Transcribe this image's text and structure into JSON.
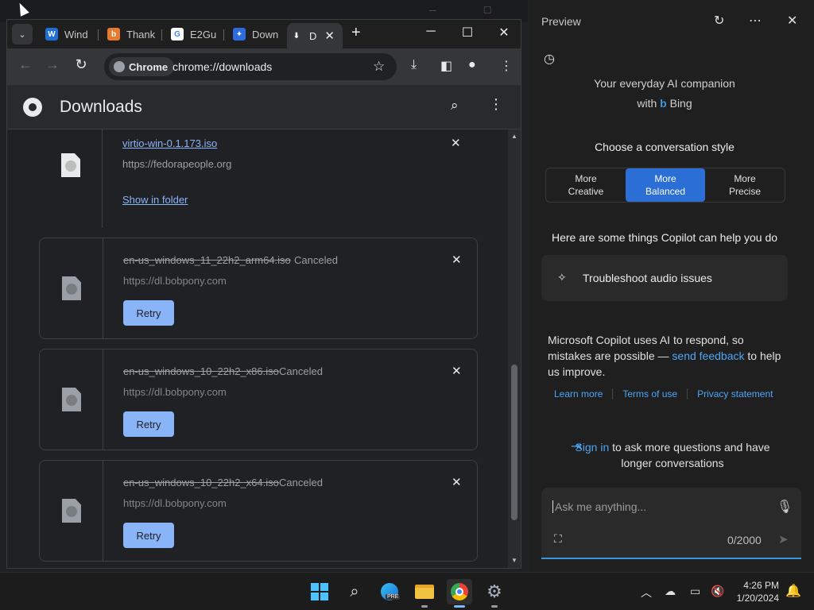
{
  "chrome": {
    "tabs": [
      {
        "label": "Wind",
        "favicon_color": "#1f6fd6",
        "favicon": "W"
      },
      {
        "label": "Thank",
        "favicon_color": "#e87a2e",
        "favicon": "b"
      },
      {
        "label": "E2Gu",
        "favicon_color": "#4285f4",
        "favicon": "G"
      },
      {
        "label": "Down",
        "favicon_color": "#2f6be0",
        "favicon": "✦"
      },
      {
        "label": "D",
        "favicon_color": "#35363a",
        "favicon": "⬇"
      }
    ],
    "omnibox": {
      "chip": "Chrome",
      "url": "chrome://downloads"
    },
    "page_title": "Downloads"
  },
  "downloads": [
    {
      "name": "virtio-win-0.1.173.iso",
      "source": "https://fedorapeople.org",
      "status": "",
      "action": "Show in folder"
    },
    {
      "name": "en-us_windows_11_22h2_arm64.iso",
      "source": "https://dl.bobpony.com",
      "status": "Canceled",
      "action": "Retry"
    },
    {
      "name": "en-us_windows_10_22h2_x86.iso",
      "source": "https://dl.bobpony.com",
      "status": "Canceled",
      "action": "Retry"
    },
    {
      "name": "en-us_windows_10_22h2_x64.iso",
      "source": "https://dl.bobpony.com",
      "status": "Canceled",
      "action": "Retry"
    }
  ],
  "copilot": {
    "title": "Preview",
    "tagline1": "Your everyday AI companion",
    "tagline2_prefix": "with",
    "tagline2_brand": "Bing",
    "choose": "Choose a conversation style",
    "styles": [
      "More\nCreative",
      "More\nBalanced",
      "More\nPrecise"
    ],
    "selected_style": 1,
    "help": "Here are some things Copilot can help you do",
    "suggestion": "Troubleshoot audio issues",
    "disclaimer_a": "Microsoft Copilot uses AI to respond, so mistakes are possible — ",
    "disclaimer_link": "send feedback",
    "disclaimer_b": " to help us improve.",
    "links": [
      "Learn more",
      "Terms of use",
      "Privacy statement"
    ],
    "signin_link": "Sign in",
    "signin_rest": " to ask more questions and have longer conversations",
    "placeholder": "Ask me anything...",
    "counter": "0/2000",
    "accent": "#3a96dd",
    "selected_color": "#2b6fd6"
  },
  "taskbar": {
    "time": "4:26 PM",
    "date": "1/20/2024",
    "edge_badge": "PRE"
  }
}
